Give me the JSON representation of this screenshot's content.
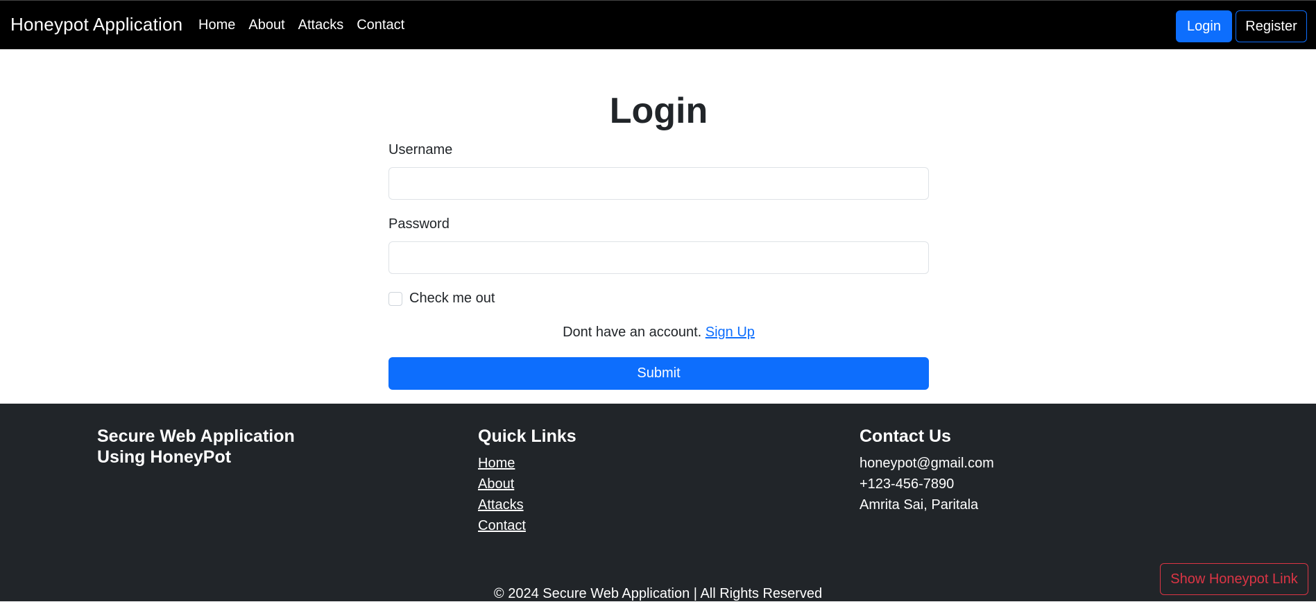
{
  "navbar": {
    "brand": "Honeypot Application",
    "links": [
      "Home",
      "About",
      "Attacks",
      "Contact"
    ],
    "login_label": "Login",
    "register_label": "Register"
  },
  "login_form": {
    "title": "Login",
    "username_label": "Username",
    "username_value": "",
    "password_label": "Password",
    "password_value": "",
    "checkbox_label": "Check me out",
    "checkbox_checked": false,
    "signup_text": "Dont have an account.",
    "signup_link": "Sign Up",
    "submit_label": "Submit"
  },
  "footer": {
    "about_heading": "Secure Web Application Using HoneyPot",
    "quick_links_heading": "Quick Links",
    "quick_links": [
      "Home",
      "About",
      "Attacks",
      "Contact"
    ],
    "contact_heading": "Contact Us",
    "contact_lines": [
      "honeypot@gmail.com",
      "+123-456-7890",
      "Amrita Sai, Paritala"
    ],
    "copyright": "© 2024 Secure Web Application | All Rights Reserved",
    "honeypot_button_label": "Show Honeypot Link"
  },
  "colors": {
    "primary": "#0d6efd",
    "danger": "#dc3545",
    "navbar_bg": "#000000",
    "footer_bg": "#212529"
  }
}
